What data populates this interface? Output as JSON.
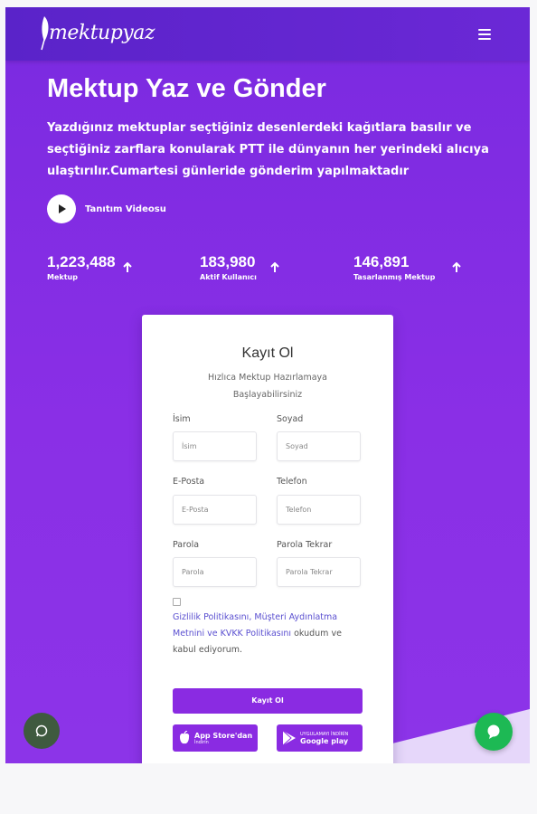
{
  "header": {
    "logo_text": "mektupyaz",
    "logo_icon": "feather-icon",
    "menu_icon": "hamburger-menu-icon"
  },
  "hero": {
    "title": "Mektup Yaz ve Gönder",
    "description": "Yazdığınız mektuplar seçtiğiniz desenlerdeki kağıtlara basılır ve seçtiğiniz zarflara konularak PTT ile dünyanın her yerindeki alıcıya ulaştırılır.Cumartesi günleride gönderim yapılmaktadır",
    "video_label": "Tanıtım Videosu",
    "video_icon": "play-icon"
  },
  "stats": [
    {
      "value": "1,223,488",
      "label": "Mektup"
    },
    {
      "value": "183,980",
      "label": "Aktif Kullanıcı"
    },
    {
      "value": "146,891",
      "label": "Tasarlanmış Mektup"
    }
  ],
  "form": {
    "title": "Kayıt Ol",
    "subtitle": "Hızlıca Mektup Hazırlamaya Başlayabilirsiniz",
    "fields": {
      "first_name": {
        "label": "İsim",
        "placeholder": "İsim"
      },
      "last_name": {
        "label": "Soyad",
        "placeholder": "Soyad"
      },
      "email": {
        "label": "E-Posta",
        "placeholder": "E-Posta"
      },
      "phone": {
        "label": "Telefon",
        "placeholder": "Telefon"
      },
      "password": {
        "label": "Parola",
        "placeholder": "Parola"
      },
      "password_repeat": {
        "label": "Parola Tekrar",
        "placeholder": "Parola Tekrar"
      }
    },
    "consent": {
      "link1": "Gizlilik Politikasını,",
      "link2": "Müşteri Aydınlatma Metnini ve KVKK Politikasını",
      "suffix": " okudum ve kabul ediyorum."
    },
    "submit_label": "Kayıt Ol",
    "appstore": {
      "small": "",
      "big": "App Store'dan",
      "sub": "İndirin"
    },
    "googleplay": {
      "small": "UYGULAMAYI İNDİRİN",
      "big": "Google play"
    }
  },
  "colors": {
    "brand": "#8a2be2",
    "header": "#6226d0",
    "chat": "#1db954"
  }
}
